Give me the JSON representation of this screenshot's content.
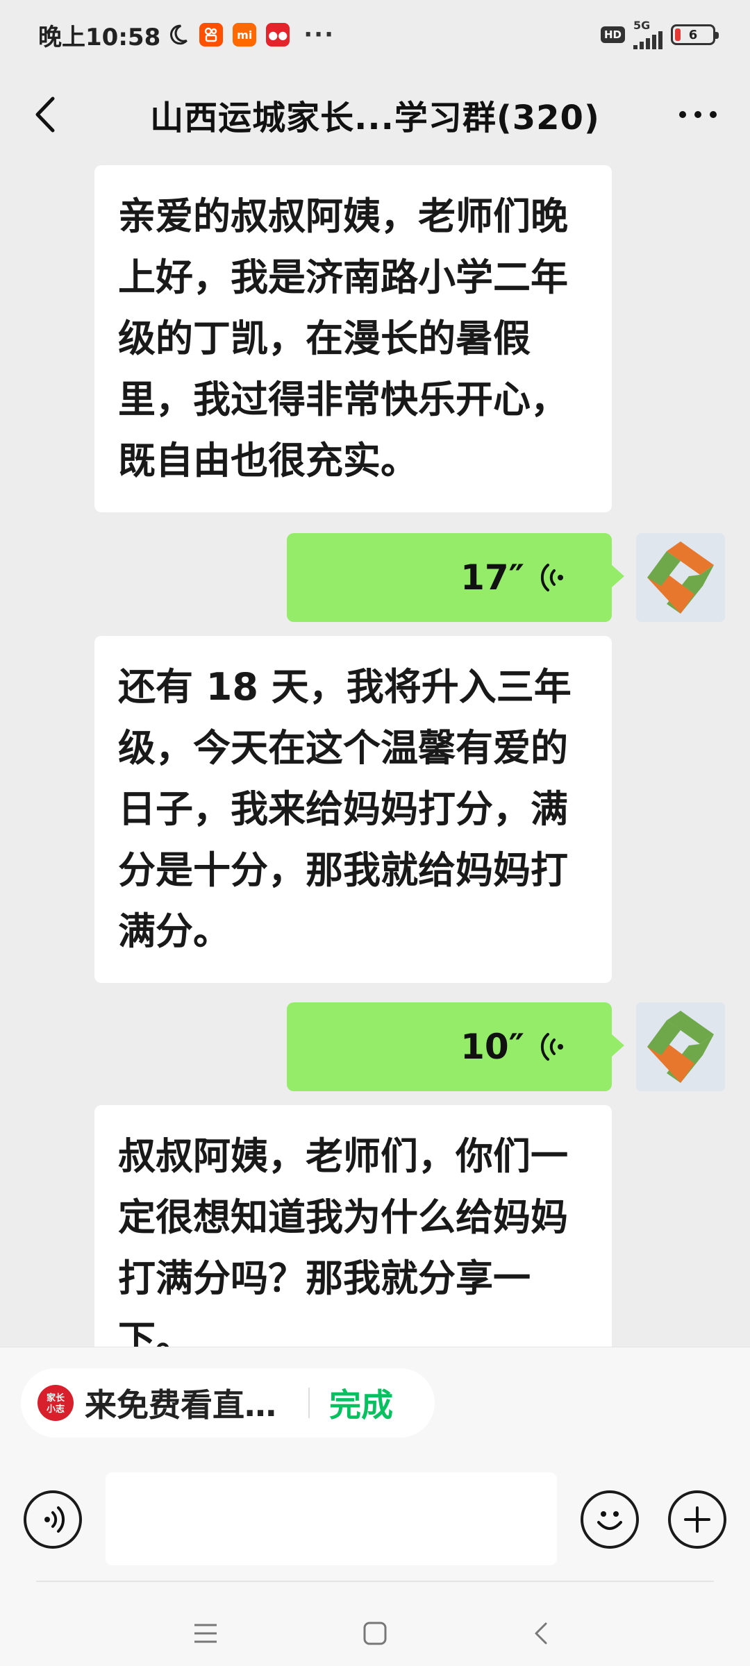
{
  "status_bar": {
    "time": "晚上10:58",
    "apps": [
      {
        "icon": "kuaishou-app-icon",
        "label": "",
        "color": "#ff5000"
      },
      {
        "icon": "mi-app-icon",
        "label": "mi",
        "color": "#ff6900"
      },
      {
        "icon": "red-app-icon",
        "label": "●●",
        "color": "#e4232b"
      }
    ],
    "more": "···",
    "hd": "HD",
    "network": "5G",
    "battery": "6"
  },
  "header": {
    "back_icon": "chevron-left-icon",
    "title": "山西运城家长...学习群(320)",
    "more_icon": "more-icon"
  },
  "messages": [
    {
      "type": "text",
      "side": "left",
      "text": "亲爱的叔叔阿姨，老师们晚上好，我是济南路小学二年级的丁凯，在漫长的暑假里，我过得非常快乐开心，既自由也很充实。"
    },
    {
      "type": "voice",
      "side": "right",
      "duration": "17″"
    },
    {
      "type": "text",
      "side": "left",
      "text": "还有 18 天，我将升入三年级，今天在这个温馨有爱的日子，我来给妈妈打分，满分是十分，那我就给妈妈打满分。"
    },
    {
      "type": "voice",
      "side": "right",
      "duration": "10″"
    },
    {
      "type": "text",
      "side": "left",
      "text": "叔叔阿姨，老师们，你们一定很想知道我为什么给妈妈打满分吗？那我就分享一下。"
    }
  ],
  "quick_reply": {
    "logo_text": "家长小志",
    "text": "来免费看直…",
    "done_label": "完成",
    "done_color": "#07c160"
  },
  "composer": {
    "voice_icon": "voice-input-icon",
    "input_value": "",
    "emoji_icon": "emoji-icon",
    "plus_icon": "plus-icon"
  },
  "system_nav": {
    "menu_icon": "menu-icon",
    "home_icon": "home-icon",
    "back_icon": "back-icon"
  },
  "colors": {
    "background": "#ededed",
    "my_bubble": "#95ec69",
    "other_bubble": "#ffffff"
  }
}
